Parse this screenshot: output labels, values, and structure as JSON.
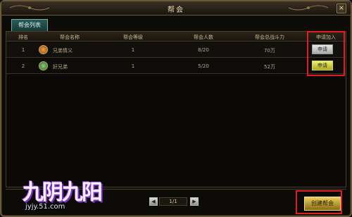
{
  "window": {
    "title": "帮会",
    "close_label": "×"
  },
  "tabs": [
    {
      "label": "帮会列表",
      "active": true
    }
  ],
  "table": {
    "headers": [
      "排名",
      "帮会名称",
      "帮会等级",
      "帮会人数",
      "帮会总战斗力",
      "申请加入"
    ],
    "rows": [
      {
        "rank": "1",
        "name": "兄弟情义",
        "level": "1",
        "members": "8/20",
        "power": "70万",
        "apply": "申请",
        "icon": "guild-emblem-orange-icon"
      },
      {
        "rank": "2",
        "name": "好兄弟",
        "level": "1",
        "members": "5/20",
        "power": "52万",
        "apply": "申请",
        "icon": "guild-emblem-green-icon"
      }
    ]
  },
  "pager": {
    "prev": "◀",
    "label": "1/1",
    "next": "▶"
  },
  "create_button": "创建帮会",
  "logo": {
    "text": "九阴九阳",
    "url": "jyjy.51.com"
  },
  "colors": {
    "highlight": "#e02020",
    "accent_gold": "#e8d060",
    "tab_teal": "#2a5a5a"
  }
}
